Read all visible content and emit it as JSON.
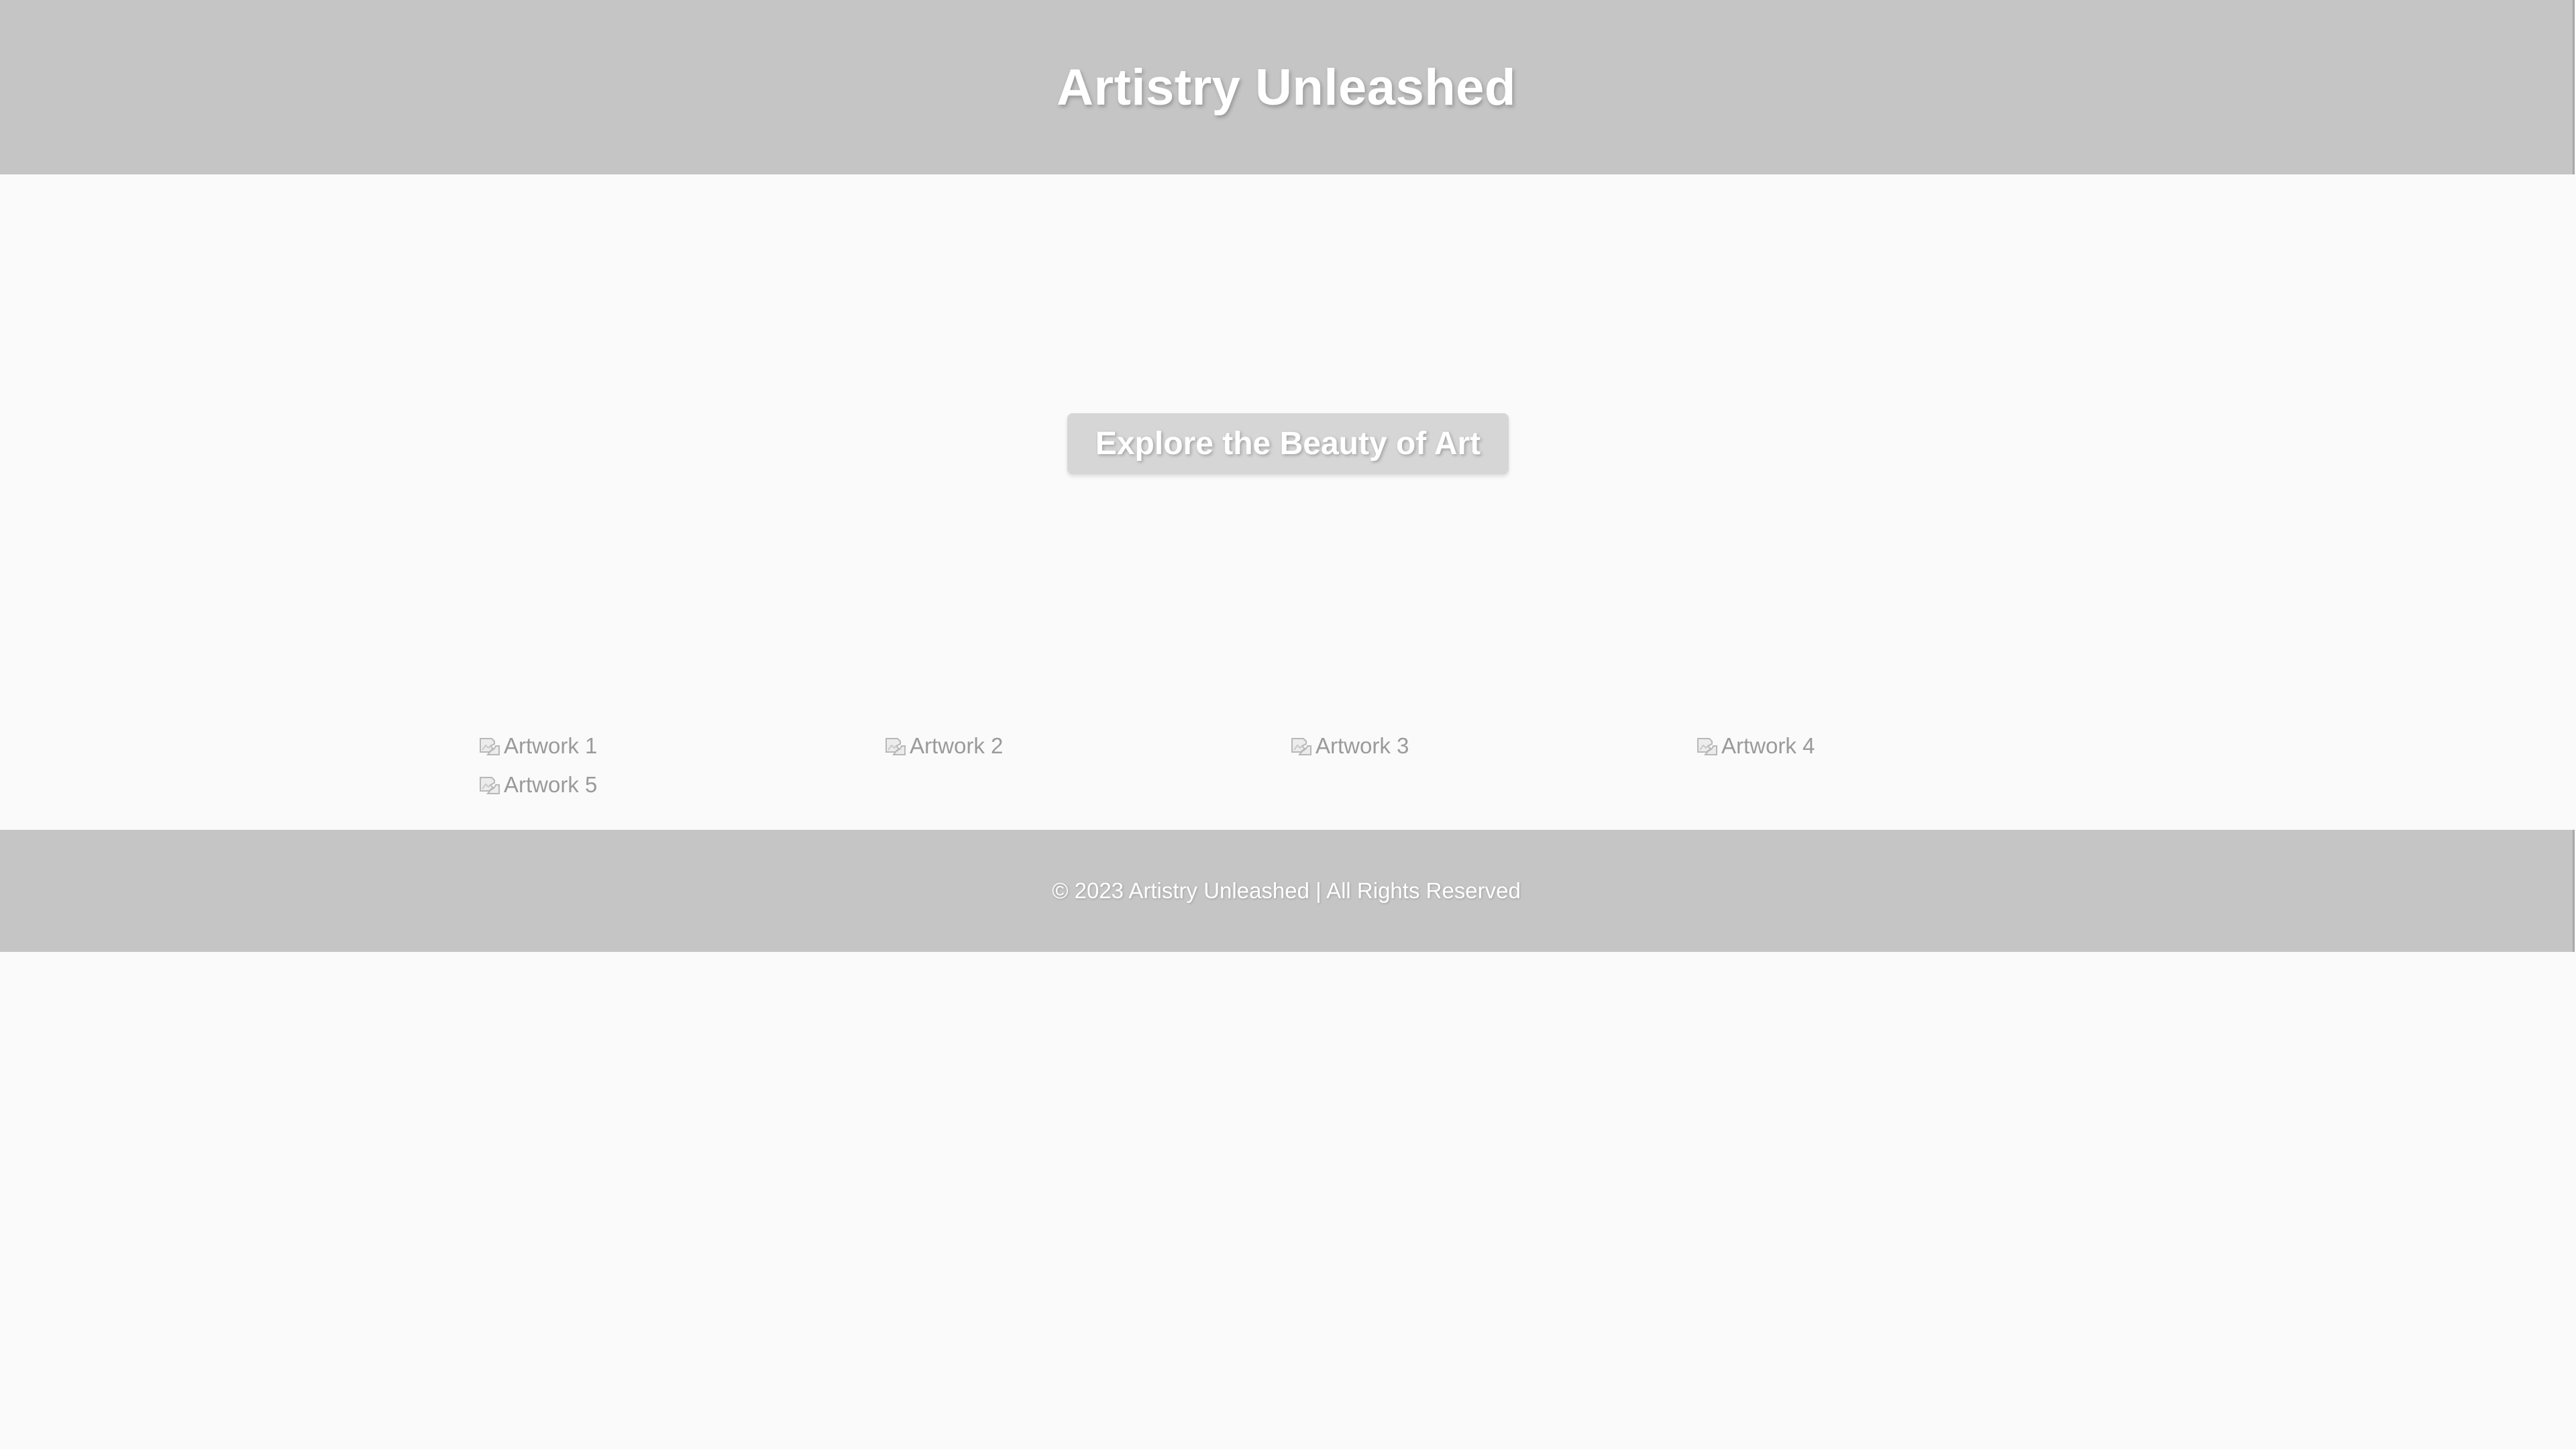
{
  "header": {
    "title": "Artistry Unleashed"
  },
  "hero": {
    "button_label": "Explore the Beauty of Art"
  },
  "gallery": {
    "items": [
      {
        "alt": "Artwork 1",
        "icon": "broken-image-icon"
      },
      {
        "alt": "Artwork 2",
        "icon": "broken-image-icon"
      },
      {
        "alt": "Artwork 3",
        "icon": "broken-image-icon"
      },
      {
        "alt": "Artwork 4",
        "icon": "broken-image-icon"
      },
      {
        "alt": "Artwork 5",
        "icon": "broken-image-icon"
      }
    ]
  },
  "footer": {
    "text": "© 2023 Artistry Unleashed | All Rights Reserved"
  },
  "colors": {
    "header_bg": "#c5c5c5",
    "page_bg": "#fafafa",
    "button_bg": "#d6d6d6",
    "text_white": "#ffffff",
    "gallery_text": "#9a9a9a"
  }
}
